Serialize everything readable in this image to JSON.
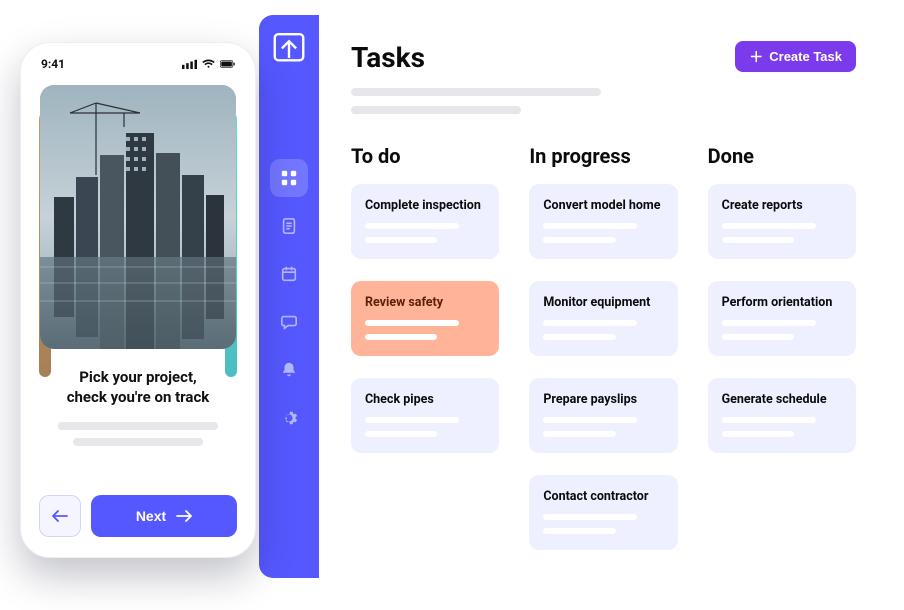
{
  "phone": {
    "status_time": "9:41",
    "onboarding_title_line1": "Pick your project,",
    "onboarding_title_line2": "check you're on track",
    "next_label": "Next"
  },
  "dashboard": {
    "title": "Tasks",
    "create_label": "Create Task",
    "columns": [
      {
        "title": "To do",
        "cards": [
          "Complete inspection",
          "Review safety",
          "Check pipes"
        ],
        "selected_index": 1
      },
      {
        "title": "In progress",
        "cards": [
          "Convert model home",
          "Monitor equipment",
          "Prepare payslips",
          "Contact contractor"
        ],
        "selected_index": -1
      },
      {
        "title": "Done",
        "cards": [
          "Create reports",
          "Perform orientation",
          "Generate schedule"
        ],
        "selected_index": -1
      }
    ]
  }
}
